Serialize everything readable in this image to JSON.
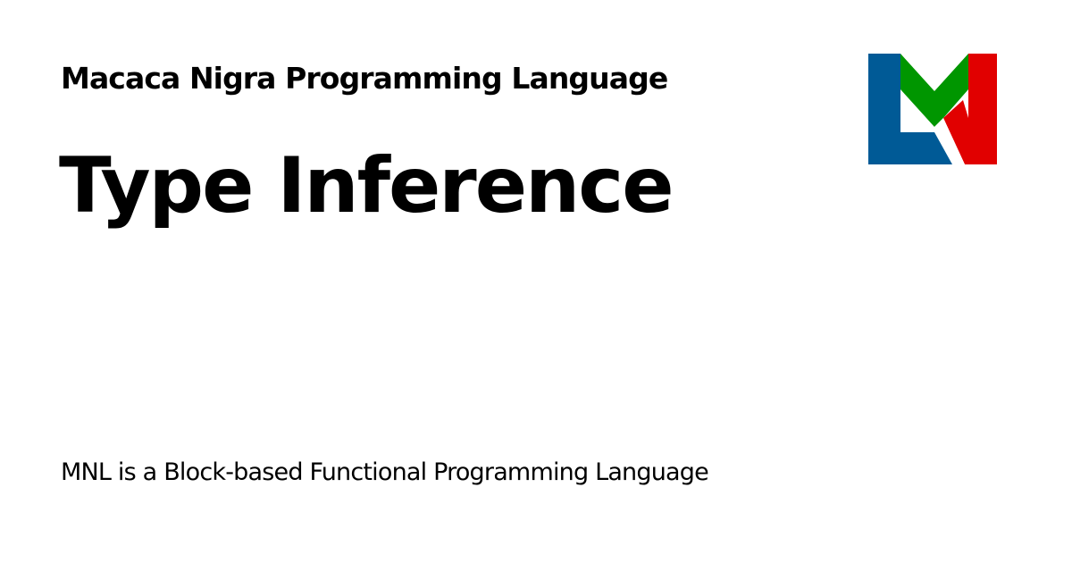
{
  "header": {
    "site_name": "Macaca Nigra Programming Language",
    "logo_icon": "mnl-logo-icon"
  },
  "main": {
    "title": "Type Inference"
  },
  "footer": {
    "tagline": "MNL is a Block-based Functional Programming Language"
  },
  "colors": {
    "background": "#ffffff",
    "text": "#000000",
    "logo_blue": "#005a96",
    "logo_green": "#009600",
    "logo_red": "#e10000"
  }
}
